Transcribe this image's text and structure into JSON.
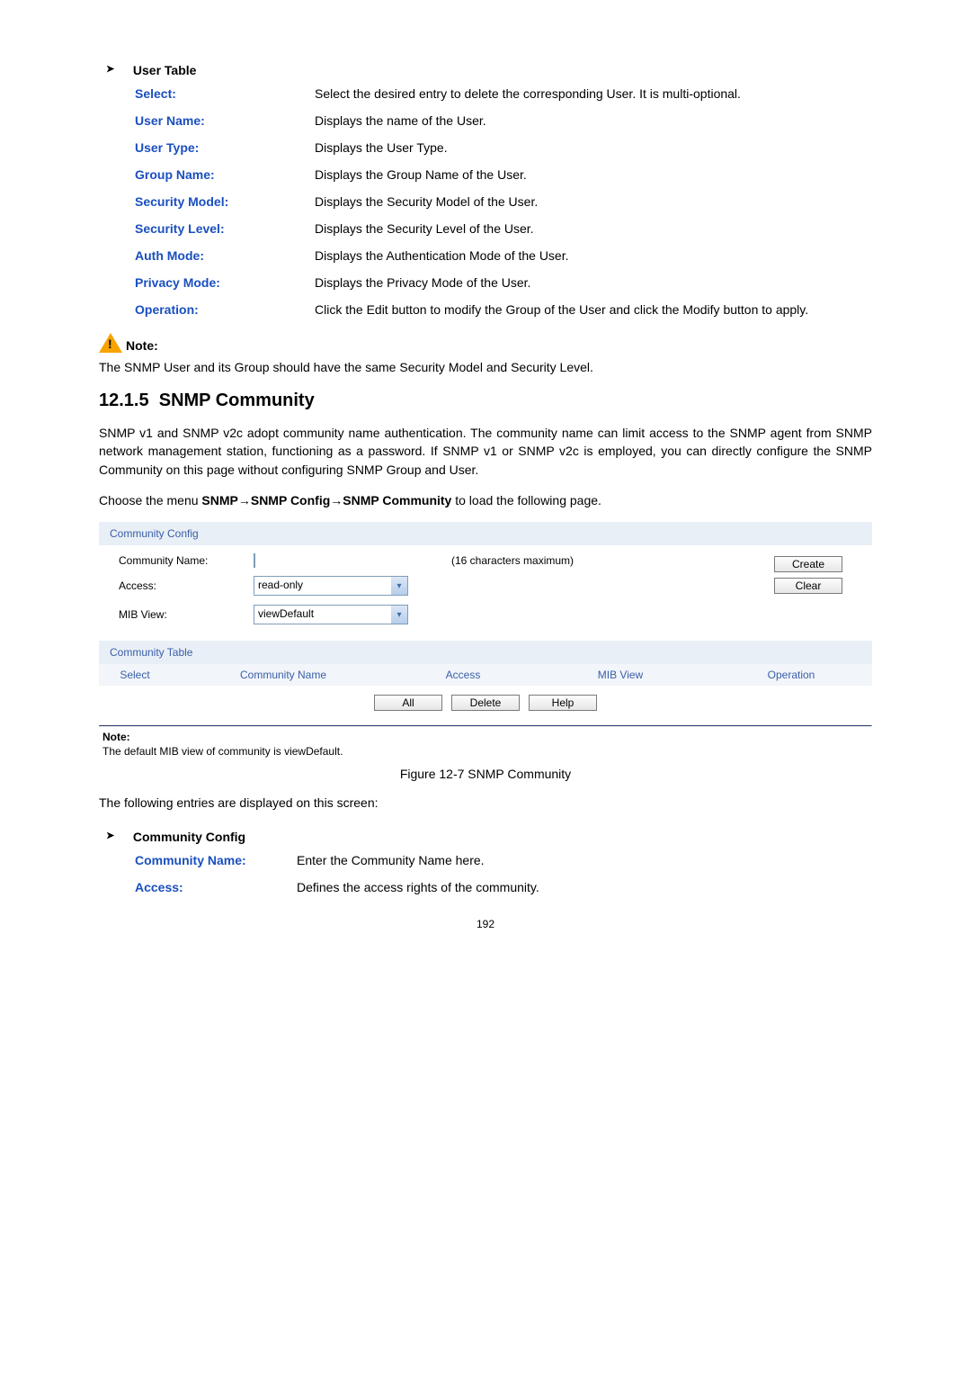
{
  "userTable": {
    "heading": "User Table",
    "rows": [
      {
        "term": "Select:",
        "desc": "Select the desired entry to delete the corresponding User. It is multi-optional."
      },
      {
        "term": "User Name:",
        "desc": "Displays the name of the User."
      },
      {
        "term": "User Type:",
        "desc": "Displays the User Type."
      },
      {
        "term": "Group Name:",
        "desc": "Displays the Group Name of the User."
      },
      {
        "term": "Security Model:",
        "desc": "Displays the Security Model of the User."
      },
      {
        "term": "Security Level:",
        "desc": "Displays the Security Level of the User."
      },
      {
        "term": "Auth Mode:",
        "desc": "Displays the Authentication Mode of the User."
      },
      {
        "term": "Privacy Mode:",
        "desc": "Displays the Privacy Mode of the User."
      },
      {
        "term": "Operation:",
        "desc": "Click the Edit button to modify the Group of the User and click the Modify button to apply."
      }
    ]
  },
  "note1": {
    "label": "Note:",
    "text": "The SNMP User and its Group should have the same Security Model and Security Level."
  },
  "section": {
    "number": "12.1.5",
    "title": "SNMP Community"
  },
  "para1": "SNMP v1 and SNMP v2c adopt community name authentication. The community name can limit access to the SNMP agent from SNMP network management station, functioning as a password. If SNMP v1 or SNMP v2c is employed, you can directly configure the SNMP Community on this page without configuring SNMP Group and User.",
  "menuLine": {
    "prefix": "Choose the menu ",
    "bold": "SNMP→SNMP Config→SNMP Community",
    "suffix": " to load the following page."
  },
  "fig": {
    "panel1Title": "Community Config",
    "communityNameLabel": "Community Name:",
    "communityNameHint": "(16 characters maximum)",
    "accessLabel": "Access:",
    "accessValue": "read-only",
    "mibViewLabel": "MIB View:",
    "mibViewValue": "viewDefault",
    "createBtn": "Create",
    "clearBtn": "Clear",
    "panel2Title": "Community Table",
    "cols": [
      "Select",
      "Community Name",
      "Access",
      "MIB View",
      "Operation"
    ],
    "allBtn": "All",
    "deleteBtn": "Delete",
    "helpBtn": "Help",
    "noteHead": "Note:",
    "noteText": "The default MIB view of community is viewDefault."
  },
  "caption": "Figure 12-7 SNMP Community",
  "entriesLine": "The following entries are displayed on this screen:",
  "communityConfig": {
    "heading": "Community Config",
    "rows": [
      {
        "term": "Community Name:",
        "desc": "Enter the Community Name here."
      },
      {
        "term": "Access:",
        "desc": "Defines the access rights of the community."
      }
    ]
  },
  "pageNumber": "192"
}
